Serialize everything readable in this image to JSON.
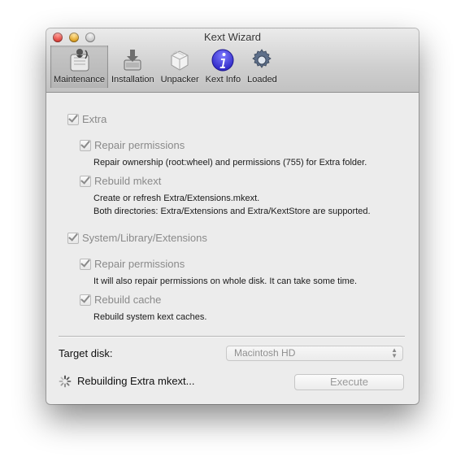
{
  "window": {
    "title": "Kext Wizard"
  },
  "toolbar": {
    "items": [
      {
        "label": "Maintenance",
        "icon": "maintenance-icon",
        "selected": true
      },
      {
        "label": "Installation",
        "icon": "installation-icon"
      },
      {
        "label": "Unpacker",
        "icon": "unpacker-icon"
      },
      {
        "label": "Kext Info",
        "icon": "info-icon"
      },
      {
        "label": "Loaded",
        "icon": "gear-icon"
      }
    ]
  },
  "extra": {
    "label": "Extra",
    "repair_permissions": {
      "label": "Repair permissions",
      "desc": "Repair ownership (root:wheel) and permissions (755) for Extra folder."
    },
    "rebuild_mkext": {
      "label": "Rebuild mkext",
      "desc_line1": "Create or refresh Extra/Extensions.mkext.",
      "desc_line2": "Both directories: Extra/Extensions and Extra/KextStore are supported."
    }
  },
  "system": {
    "label": "System/Library/Extensions",
    "repair_permissions": {
      "label": "Repair permissions",
      "desc": "It will also repair permissions on whole disk. It can take some time."
    },
    "rebuild_cache": {
      "label": "Rebuild cache",
      "desc": "Rebuild system kext caches."
    }
  },
  "target": {
    "label": "Target disk:",
    "value": "Macintosh HD"
  },
  "status": {
    "text": "Rebuilding Extra mkext..."
  },
  "execute": {
    "label": "Execute"
  },
  "colors": {
    "disabled_text": "#8a8a8a",
    "info_icon_blue": "#3b35d6"
  }
}
